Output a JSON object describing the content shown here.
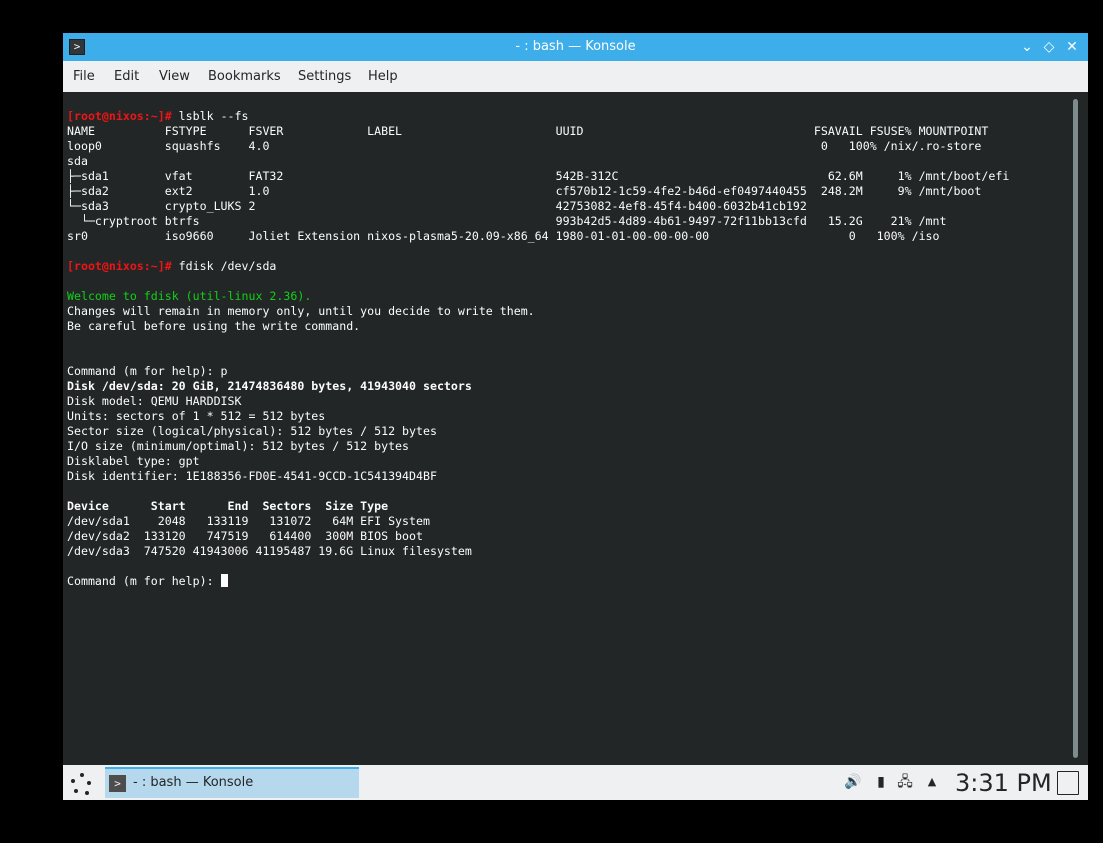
{
  "window": {
    "title": "- : bash — Konsole",
    "app_icon": ">",
    "buttons": {
      "minimize": "⌄",
      "maximize": "◇",
      "close": "✕"
    }
  },
  "menu": {
    "file": "File",
    "edit": "Edit",
    "view": "View",
    "bookmarks": "Bookmarks",
    "settings": "Settings",
    "help": "Help"
  },
  "terminal": {
    "prompt1": "[root@nixos:~]#",
    "cmd1": " lsblk --fs",
    "lsblk_header": "NAME          FSTYPE      FSVER            LABEL                      UUID                                 FSAVAIL FSUSE% MOUNTPOINT",
    "lsblk_rows": [
      "loop0         squashfs    4.0                                                                               0   100% /nix/.ro-store",
      "sda",
      "├─sda1        vfat        FAT32                                       542B-312C                              62.6M     1% /mnt/boot/efi",
      "├─sda2        ext2        1.0                                         cf570b12-1c59-4fe2-b46d-ef0497440455  248.2M     9% /mnt/boot",
      "└─sda3        crypto_LUKS 2                                           42753082-4ef8-45f4-b400-6032b41cb192",
      "  └─cryptroot btrfs                                                   993b42d5-4d89-4b61-9497-72f11bb13cfd   15.2G    21% /mnt",
      "sr0           iso9660     Joliet Extension nixos-plasma5-20.09-x86_64 1980-01-01-00-00-00-00                    0   100% /iso"
    ],
    "prompt2": "[root@nixos:~]#",
    "cmd2": " fdisk /dev/sda",
    "welcome": "Welcome to fdisk (util-linux 2.36).",
    "changes": "Changes will remain in memory only, until you decide to write them.",
    "careful": "Be careful before using the write command.",
    "command_p": "Command (m for help): p",
    "disk_summary": "Disk /dev/sda: 20 GiB, 21474836480 bytes, 41943040 sectors",
    "disk_info": [
      "Disk model: QEMU HARDDISK",
      "Units: sectors of 1 * 512 = 512 bytes",
      "Sector size (logical/physical): 512 bytes / 512 bytes",
      "I/O size (minimum/optimal): 512 bytes / 512 bytes",
      "Disklabel type: gpt",
      "Disk identifier: 1E188356-FD0E-4541-9CCD-1C541394D4BF"
    ],
    "part_header": "Device      Start      End  Sectors  Size Type",
    "part_rows": [
      "/dev/sda1    2048   133119   131072   64M EFI System",
      "/dev/sda2  133120   747519   614400  300M BIOS boot",
      "/dev/sda3  747520 41943006 41195487 19.6G Linux filesystem"
    ],
    "command_prompt": "Command (m for help): "
  },
  "taskbar": {
    "task_label": "- : bash — Konsole",
    "task_icon": ">",
    "tray": {
      "volume": "🔊",
      "usb": "▮",
      "network": "🖧",
      "expand": "▲"
    },
    "clock": "3:31 PM"
  },
  "colors": {
    "accent": "#3daee9",
    "terminal_bg": "#232627",
    "prompt_red": "#ed1515",
    "welcome_green": "#11d116"
  }
}
